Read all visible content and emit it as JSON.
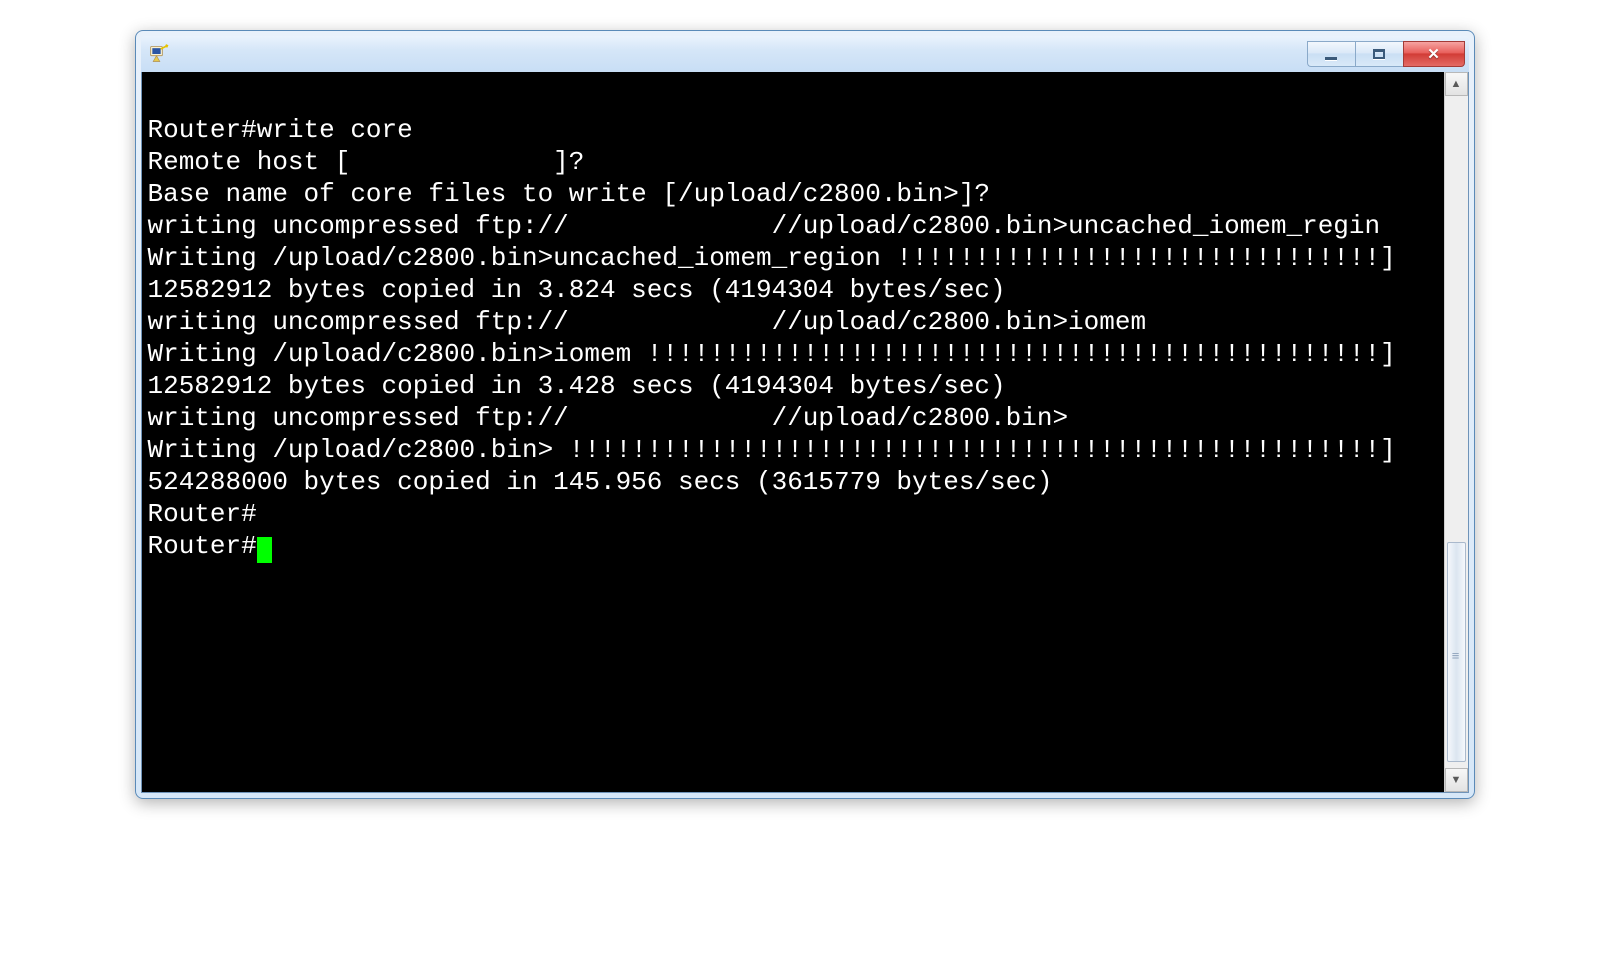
{
  "window": {
    "title": ""
  },
  "terminal": {
    "lines": [
      "Router#write core",
      "Remote host [             ]?",
      "Base name of core files to write [/upload/c2800.bin>]?",
      "writing uncompressed ftp://             //upload/c2800.bin>uncached_iomem_regin",
      "",
      "Writing /upload/c2800.bin>uncached_iomem_region !!!!!!!!!!!!!!!!!!!!!!!!!!!!!!!]",
      "12582912 bytes copied in 3.824 secs (4194304 bytes/sec)",
      "writing uncompressed ftp://             //upload/c2800.bin>iomem",
      "",
      "Writing /upload/c2800.bin>iomem !!!!!!!!!!!!!!!!!!!!!!!!!!!!!!!!!!!!!!!!!!!!!!!]",
      "12582912 bytes copied in 3.428 secs (4194304 bytes/sec)",
      "writing uncompressed ftp://             //upload/c2800.bin>",
      "",
      "Writing /upload/c2800.bin> !!!!!!!!!!!!!!!!!!!!!!!!!!!!!!!!!!!!!!!!!!!!!!!!!!!!]",
      "524288000 bytes copied in 145.956 secs (3615779 bytes/sec)",
      "Router#",
      "Router#"
    ],
    "cursor_line_index": 16
  },
  "controls": {
    "close_glyph": "✕"
  }
}
